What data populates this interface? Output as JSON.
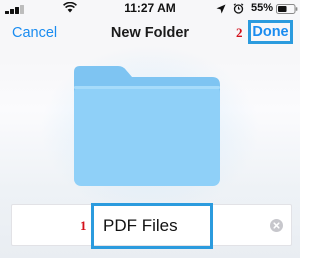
{
  "status_bar": {
    "time": "11:27 AM",
    "battery_percent": "55%",
    "battery_level": 0.55,
    "icons": [
      "signal-icon",
      "wifi-icon",
      "location-icon",
      "alarm-icon",
      "battery-icon"
    ]
  },
  "nav": {
    "cancel_label": "Cancel",
    "title": "New Folder",
    "done_label": "Done",
    "done_step_marker": "2"
  },
  "folder": {
    "icon": "folder-icon",
    "color": "#8fd0f8"
  },
  "name_field": {
    "value": "PDF Files",
    "step_marker": "1",
    "clear_icon": "clear-icon"
  },
  "colors": {
    "accent": "#1a8cf0",
    "highlight_box": "#2b9bde",
    "step_marker": "#d3101a"
  }
}
